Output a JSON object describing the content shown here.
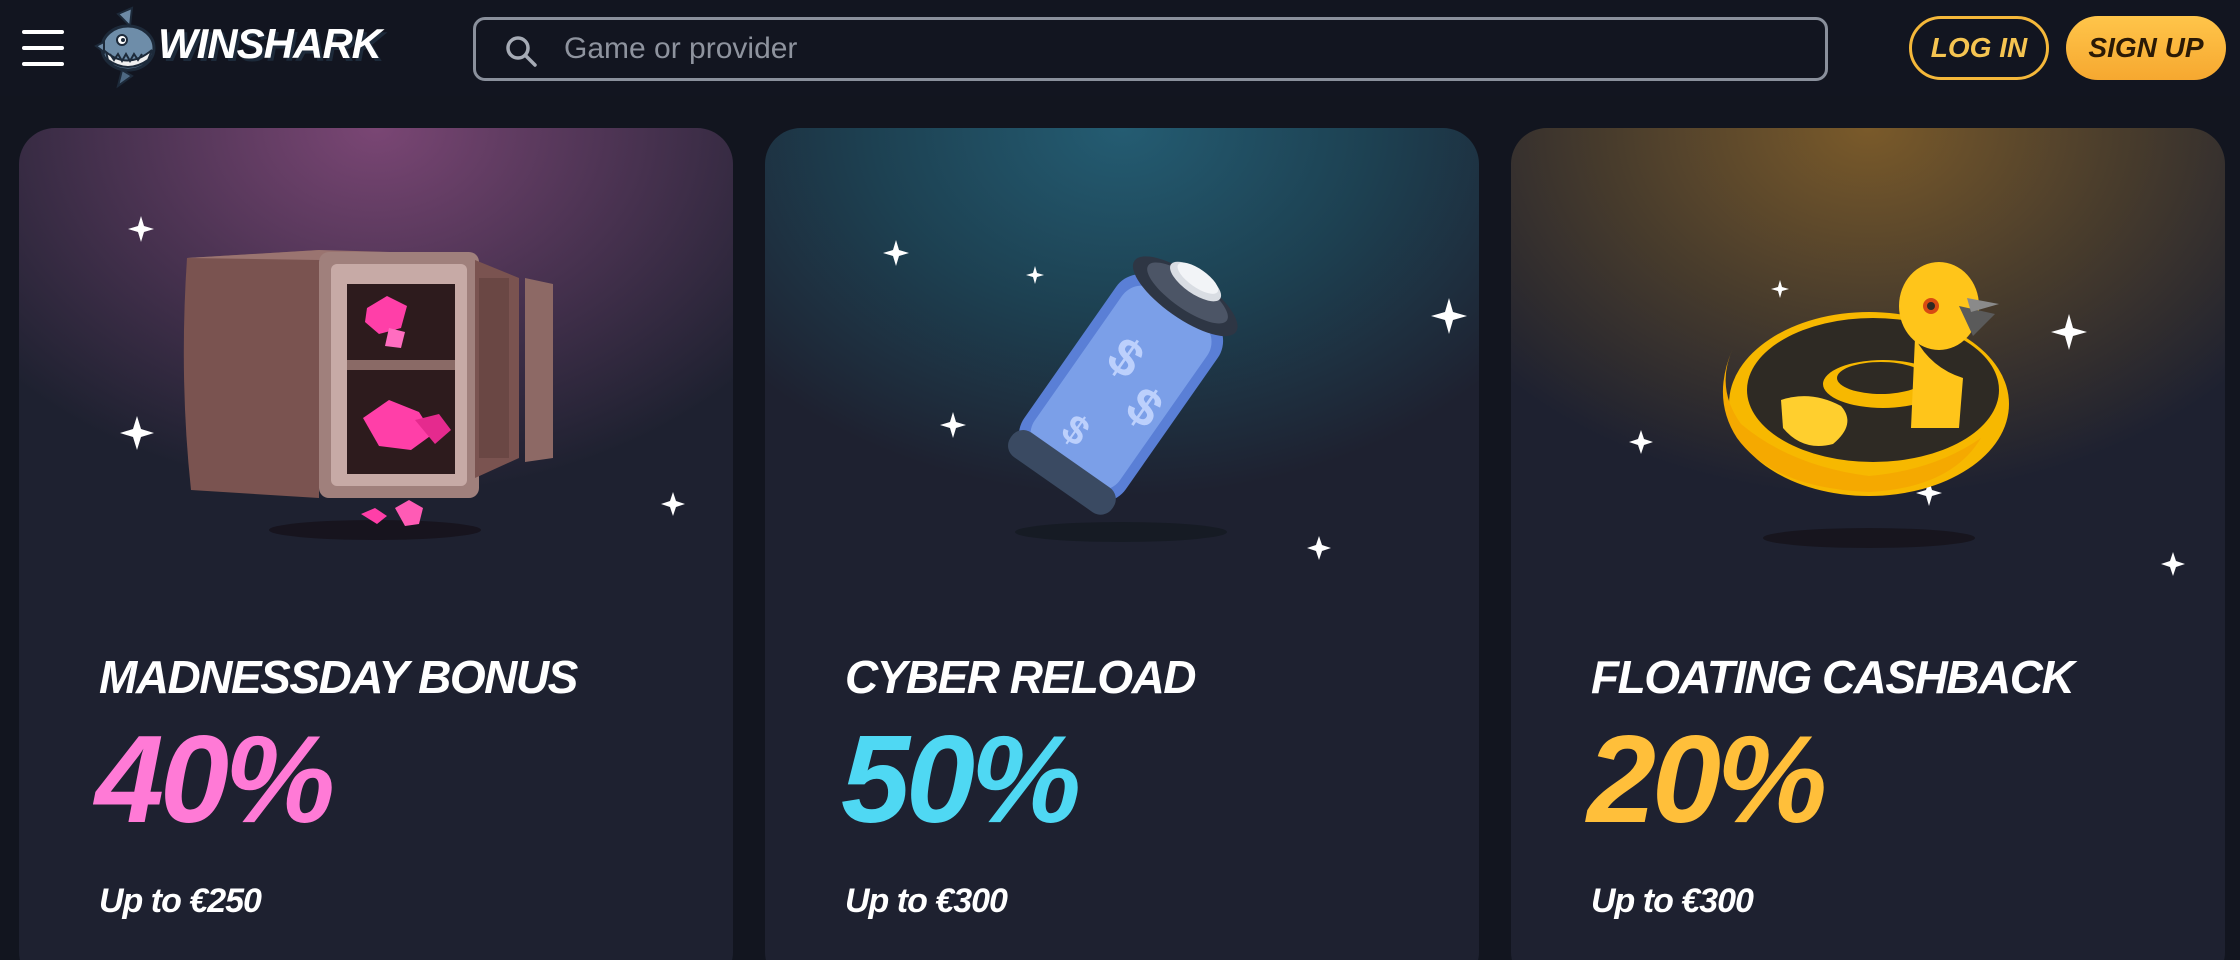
{
  "header": {
    "logo_text": "WINSHARK",
    "search_placeholder": "Game or provider",
    "login_label": "LOG IN",
    "signup_label": "SIGN UP"
  },
  "colors": {
    "accent": "#f5b83a",
    "card1_percent": "#ff7ad6",
    "card2_percent": "#4fd8f3",
    "card3_percent": "#ffbf3a"
  },
  "promotions": [
    {
      "title": "MADNESSDAY BONUS",
      "percent": "40%",
      "subtitle": "Up to €250",
      "art": "safe-with-gems-icon"
    },
    {
      "title": "CYBER RELOAD",
      "percent": "50%",
      "subtitle": "Up to €300",
      "art": "battery-dollar-icon"
    },
    {
      "title": "FLOATING CASHBACK",
      "percent": "20%",
      "subtitle": "Up to €300",
      "art": "duck-float-icon"
    }
  ]
}
